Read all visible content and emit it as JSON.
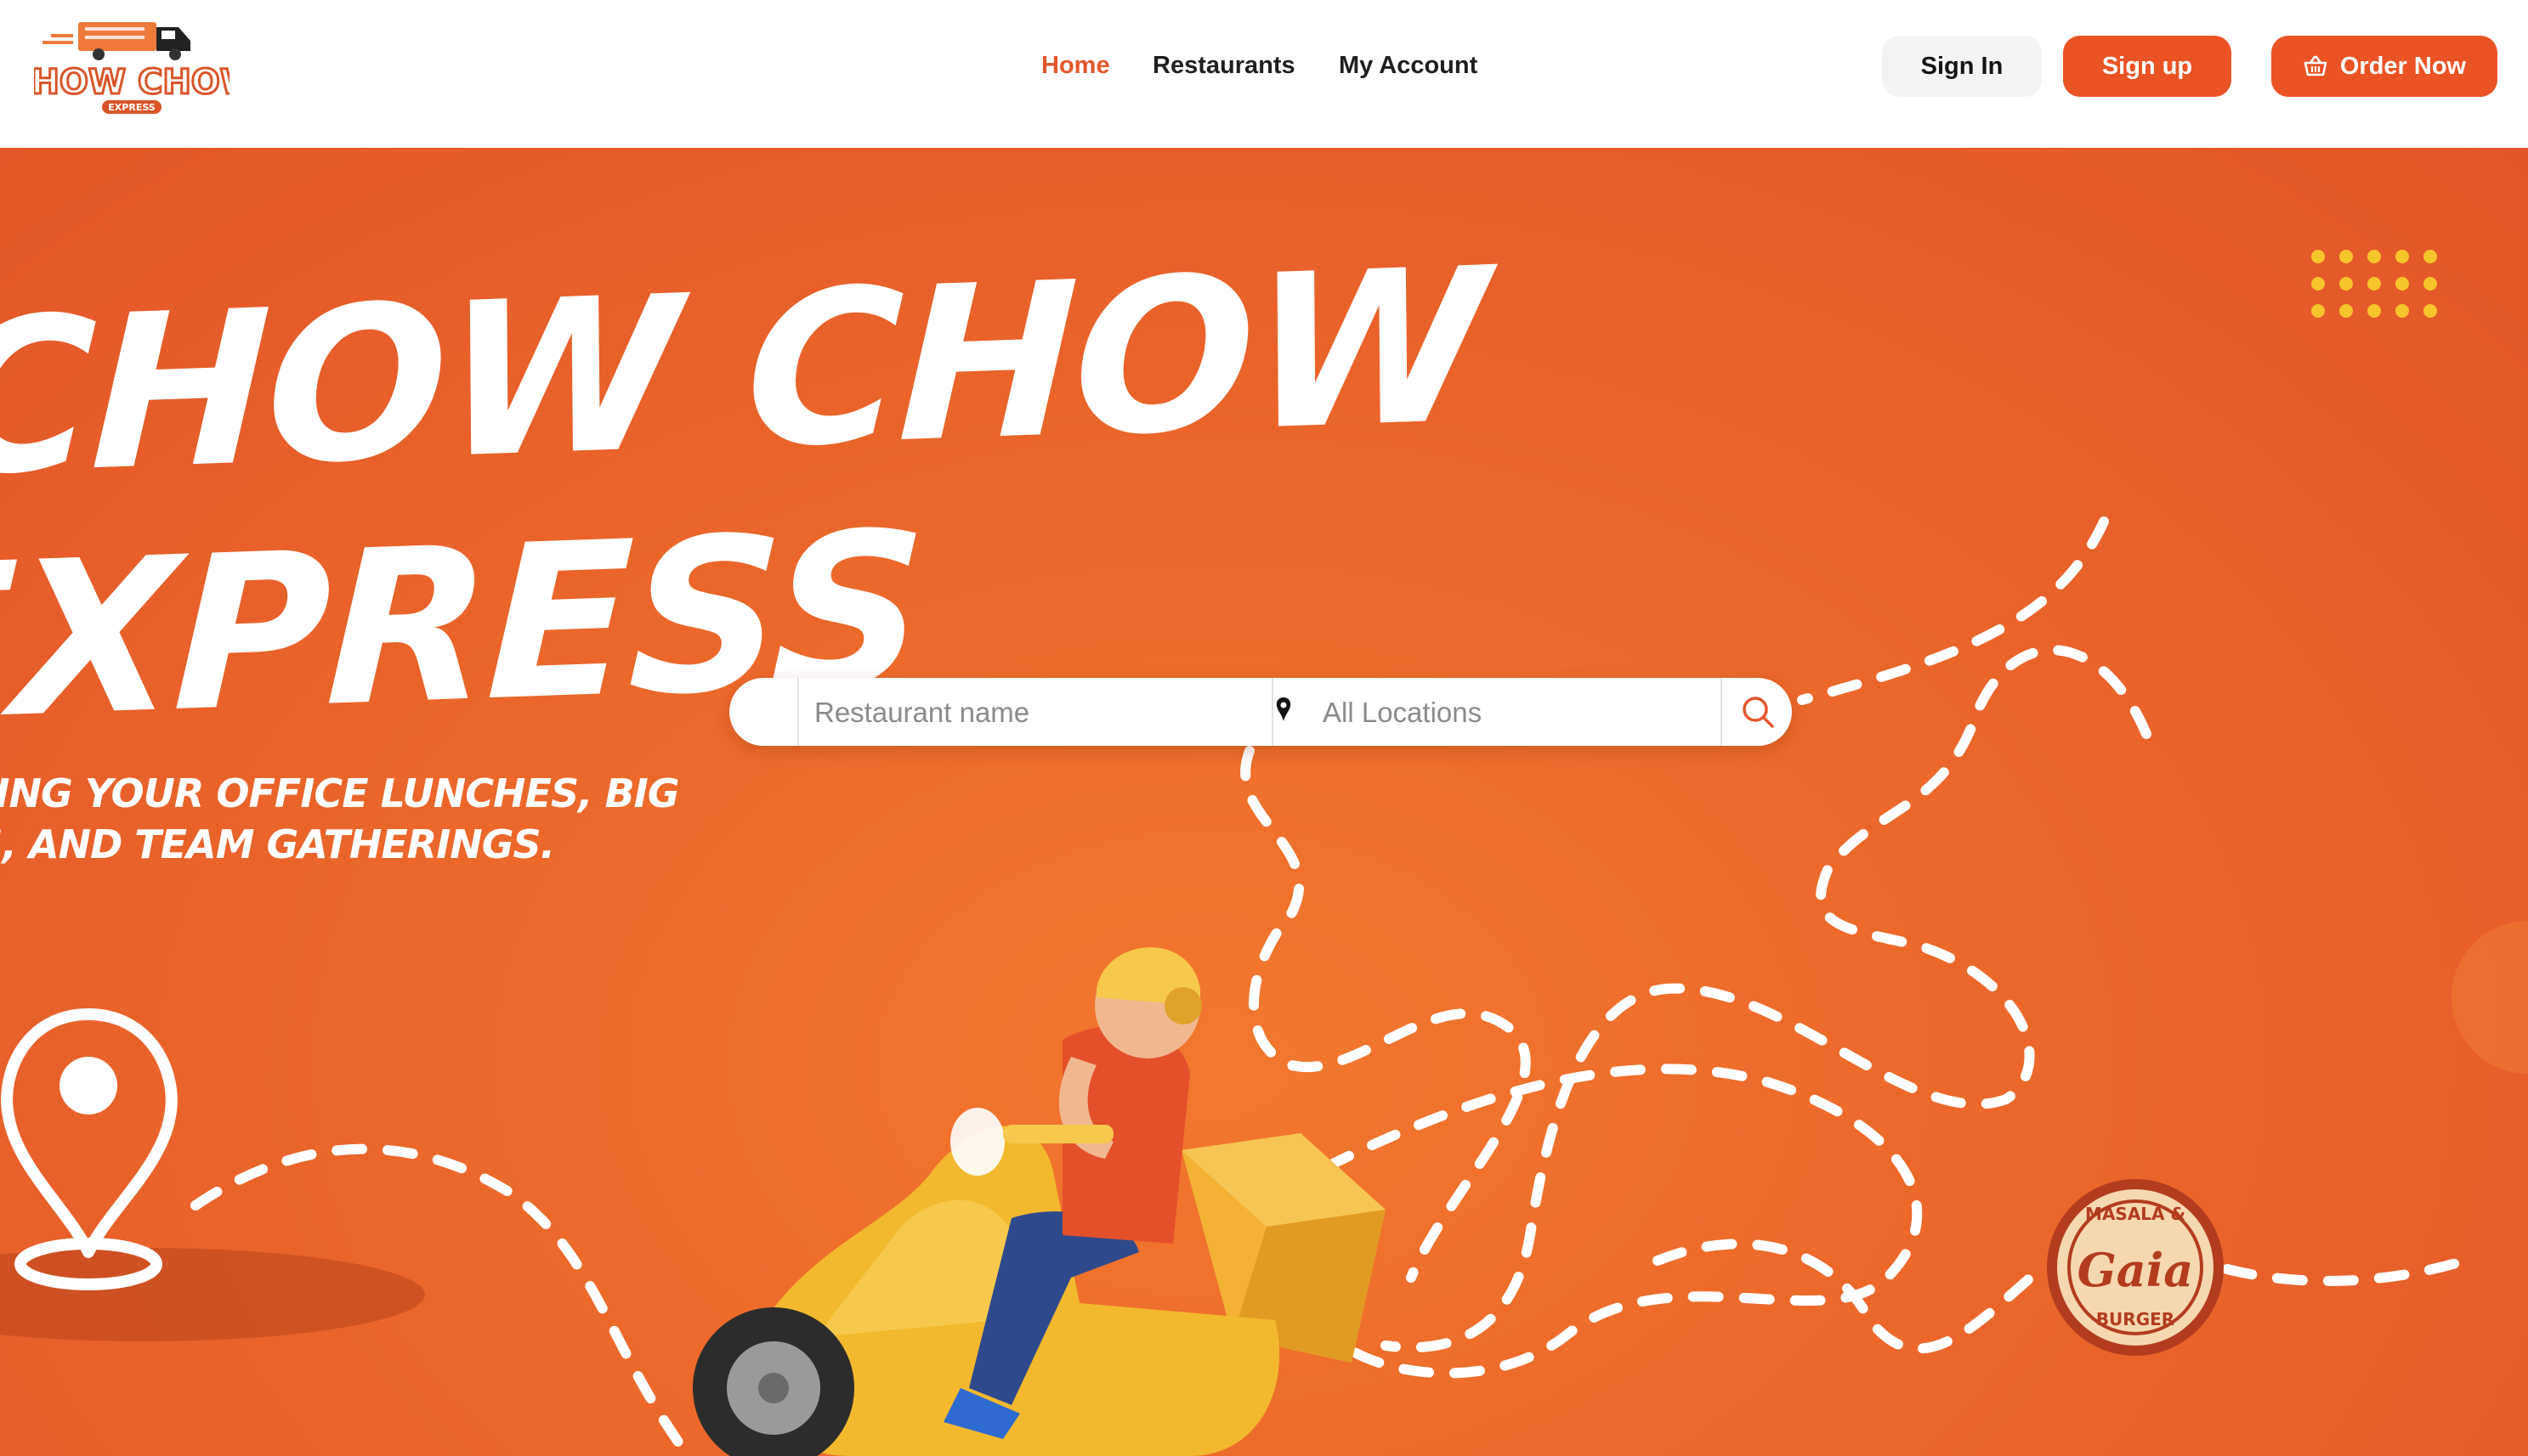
{
  "brand": {
    "logo_line1": "CHOW CHOW",
    "logo_line2": "EXPRESS",
    "accent_color": "#ea5324"
  },
  "nav": {
    "items": [
      {
        "label": "Home",
        "active": true
      },
      {
        "label": "Restaurants",
        "active": false
      },
      {
        "label": "My Account",
        "active": false
      }
    ]
  },
  "header_actions": {
    "sign_in": "Sign In",
    "sign_up": "Sign up",
    "order_now": "Order Now",
    "order_icon": "basket-icon"
  },
  "hero": {
    "title_line1": "CHOW CHOW",
    "title_line2": "EXPRESS",
    "subtitle_line1": "RING YOUR OFFICE LUNCHES, BIG",
    "subtitle_line2": "TS, AND TEAM GATHERINGS.",
    "background_color": "#ec6629",
    "badge_line1": "MASALA &",
    "badge_line2": "Gaia",
    "badge_line3": "BURGER"
  },
  "search": {
    "restaurant_placeholder": "Restaurant name",
    "restaurant_value": "",
    "location_placeholder": "All Locations",
    "location_value": "",
    "location_icon": "map-pin-icon",
    "search_icon": "search-icon"
  }
}
